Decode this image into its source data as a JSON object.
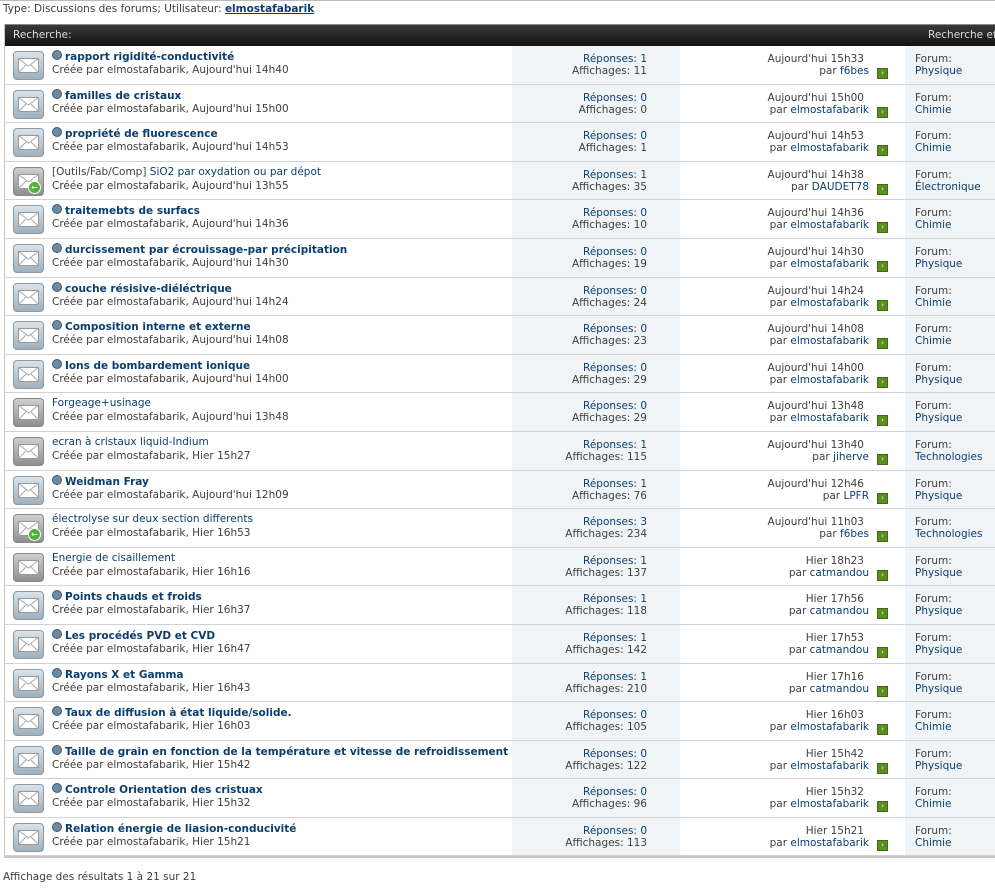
{
  "breadcrumb": {
    "prefix": "Type: Discussions des forums; Utilisateur: ",
    "user": "elmostafabarik"
  },
  "header": {
    "left": "Recherche:",
    "right": "Recherche eff"
  },
  "labels": {
    "replies": "Réponses: ",
    "views": "Affichages: ",
    "by": "par ",
    "forum": "Forum:"
  },
  "colors": {
    "link": "#0b3e6f",
    "header_bg": "#1a1a1a",
    "stats_bg": "#f1f4f6"
  },
  "rows": [
    {
      "prefix": "",
      "title": "rapport rigidité-conductivité",
      "unread": true,
      "hot": false,
      "created": "Créée par elmostafabarik, Aujourd'hui 14h40",
      "replies": "1",
      "views": "11",
      "last_date": "Aujourd'hui 15h33",
      "last_user": "f6bes",
      "forum": "Physique"
    },
    {
      "prefix": "",
      "title": "familles de cristaux",
      "unread": true,
      "hot": false,
      "created": "Créée par elmostafabarik, Aujourd'hui 15h00",
      "replies": "0",
      "views": "0",
      "last_date": "Aujourd'hui 15h00",
      "last_user": "elmostafabarik",
      "forum": "Chimie"
    },
    {
      "prefix": "",
      "title": "propriété de fluorescence",
      "unread": true,
      "hot": false,
      "created": "Créée par elmostafabarik, Aujourd'hui 14h53",
      "replies": "0",
      "views": "1",
      "last_date": "Aujourd'hui 14h53",
      "last_user": "elmostafabarik",
      "forum": "Chimie"
    },
    {
      "prefix": "[Outils/Fab/Comp] ",
      "title": "SiO2 par oxydation ou par dépot",
      "unread": false,
      "hot": true,
      "created": "Créée par elmostafabarik, Aujourd'hui 13h55",
      "replies": "1",
      "views": "35",
      "last_date": "Aujourd'hui 14h38",
      "last_user": "DAUDET78",
      "forum": "Électronique"
    },
    {
      "prefix": "",
      "title": "traitemebts de surfacs",
      "unread": true,
      "hot": false,
      "created": "Créée par elmostafabarik, Aujourd'hui 14h36",
      "replies": "0",
      "views": "10",
      "last_date": "Aujourd'hui 14h36",
      "last_user": "elmostafabarik",
      "forum": "Chimie"
    },
    {
      "prefix": "",
      "title": "durcissement par écrouissage-par précipitation",
      "unread": true,
      "hot": false,
      "created": "Créée par elmostafabarik, Aujourd'hui 14h30",
      "replies": "0",
      "views": "19",
      "last_date": "Aujourd'hui 14h30",
      "last_user": "elmostafabarik",
      "forum": "Physique"
    },
    {
      "prefix": "",
      "title": "couche résisive-diéléctrique",
      "unread": true,
      "hot": false,
      "created": "Créée par elmostafabarik, Aujourd'hui 14h24",
      "replies": "0",
      "views": "24",
      "last_date": "Aujourd'hui 14h24",
      "last_user": "elmostafabarik",
      "forum": "Chimie"
    },
    {
      "prefix": "",
      "title": "Composition interne et externe",
      "unread": true,
      "hot": false,
      "created": "Créée par elmostafabarik, Aujourd'hui 14h08",
      "replies": "0",
      "views": "23",
      "last_date": "Aujourd'hui 14h08",
      "last_user": "elmostafabarik",
      "forum": "Chimie"
    },
    {
      "prefix": "",
      "title": "Ions de bombardement ionique",
      "unread": true,
      "hot": false,
      "created": "Créée par elmostafabarik, Aujourd'hui 14h00",
      "replies": "0",
      "views": "29",
      "last_date": "Aujourd'hui 14h00",
      "last_user": "elmostafabarik",
      "forum": "Physique"
    },
    {
      "prefix": "",
      "title": "Forgeage+usinage",
      "unread": false,
      "hot": false,
      "created": "Créée par elmostafabarik, Aujourd'hui 13h48",
      "replies": "0",
      "views": "29",
      "last_date": "Aujourd'hui 13h48",
      "last_user": "elmostafabarik",
      "forum": "Physique"
    },
    {
      "prefix": "",
      "title": "ecran à cristaux liquid-Indium",
      "unread": false,
      "hot": false,
      "created": "Créée par elmostafabarik, Hier 15h27",
      "replies": "1",
      "views": "115",
      "last_date": "Aujourd'hui 13h40",
      "last_user": "jiherve",
      "forum": "Technologies"
    },
    {
      "prefix": "",
      "title": "Weidman Fray",
      "unread": true,
      "hot": false,
      "created": "Créée par elmostafabarik, Aujourd'hui 12h09",
      "replies": "1",
      "views": "76",
      "last_date": "Aujourd'hui 12h46",
      "last_user": "LPFR",
      "forum": "Physique"
    },
    {
      "prefix": "",
      "title": "électrolyse sur deux section differents",
      "unread": false,
      "hot": true,
      "created": "Créée par elmostafabarik, Hier 16h53",
      "replies": "3",
      "views": "234",
      "last_date": "Aujourd'hui 11h03",
      "last_user": "f6bes",
      "forum": "Technologies"
    },
    {
      "prefix": "",
      "title": "Energie de cisaillement",
      "unread": false,
      "hot": false,
      "created": "Créée par elmostafabarik, Hier 16h16",
      "replies": "1",
      "views": "137",
      "last_date": "Hier 18h23",
      "last_user": "catmandou",
      "forum": "Physique"
    },
    {
      "prefix": "",
      "title": "Points chauds et froids",
      "unread": true,
      "hot": false,
      "created": "Créée par elmostafabarik, Hier 16h37",
      "replies": "1",
      "views": "118",
      "last_date": "Hier 17h56",
      "last_user": "catmandou",
      "forum": "Physique"
    },
    {
      "prefix": "",
      "title": "Les procédés PVD et CVD",
      "unread": true,
      "hot": false,
      "created": "Créée par elmostafabarik, Hier 16h47",
      "replies": "1",
      "views": "142",
      "last_date": "Hier 17h53",
      "last_user": "catmandou",
      "forum": "Physique"
    },
    {
      "prefix": "",
      "title": "Rayons X et Gamma",
      "unread": true,
      "hot": false,
      "created": "Créée par elmostafabarik, Hier 16h43",
      "replies": "1",
      "views": "210",
      "last_date": "Hier 17h16",
      "last_user": "catmandou",
      "forum": "Physique"
    },
    {
      "prefix": "",
      "title": "Taux de diffusion à état liquide/solide.",
      "unread": true,
      "hot": false,
      "created": "Créée par elmostafabarik, Hier 16h03",
      "replies": "0",
      "views": "105",
      "last_date": "Hier 16h03",
      "last_user": "elmostafabarik",
      "forum": "Chimie"
    },
    {
      "prefix": "",
      "title": "Taille de grain en fonction de la température et vitesse de refroidissement",
      "unread": true,
      "hot": false,
      "created": "Créée par elmostafabarik, Hier 15h42",
      "replies": "0",
      "views": "122",
      "last_date": "Hier 15h42",
      "last_user": "elmostafabarik",
      "forum": "Physique"
    },
    {
      "prefix": "",
      "title": "Controle Orientation des cristuax",
      "unread": true,
      "hot": false,
      "created": "Créée par elmostafabarik, Hier 15h32",
      "replies": "0",
      "views": "96",
      "last_date": "Hier 15h32",
      "last_user": "elmostafabarik",
      "forum": "Chimie"
    },
    {
      "prefix": "",
      "title": "Relation énergie de liasion-conducivité",
      "unread": true,
      "hot": false,
      "created": "Créée par elmostafabarik, Hier 15h21",
      "replies": "0",
      "views": "113",
      "last_date": "Hier 15h21",
      "last_user": "elmostafabarik",
      "forum": "Chimie"
    }
  ],
  "footer": "Affichage des résultats 1 à 21 sur 21"
}
